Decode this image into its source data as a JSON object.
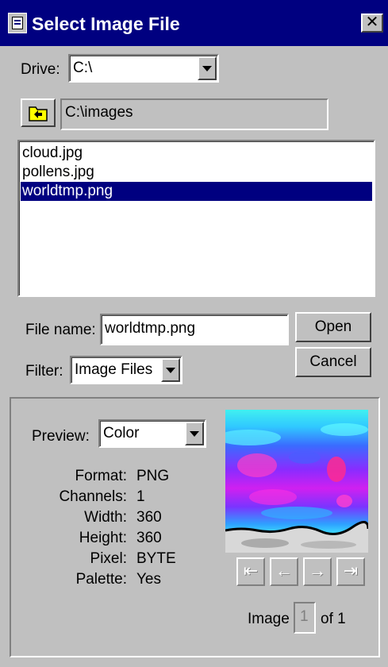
{
  "window": {
    "title": "Select Image File",
    "close_glyph": "✕"
  },
  "drive": {
    "label": "Drive:",
    "value": "C:\\"
  },
  "directory": {
    "path": "C:\\images"
  },
  "files": [
    {
      "name": "cloud.jpg",
      "selected": false
    },
    {
      "name": "pollens.jpg",
      "selected": false
    },
    {
      "name": "worldtmp.png",
      "selected": true
    }
  ],
  "filename": {
    "label": "File name:",
    "value": "worldtmp.png"
  },
  "filter": {
    "label": "Filter:",
    "value": "Image Files"
  },
  "buttons": {
    "open": "Open",
    "cancel": "Cancel"
  },
  "preview": {
    "label": "Preview:",
    "mode": "Color",
    "info": [
      {
        "label": "Format:",
        "value": "PNG"
      },
      {
        "label": "Channels:",
        "value": "1"
      },
      {
        "label": "Width:",
        "value": "360"
      },
      {
        "label": "Height:",
        "value": "360"
      },
      {
        "label": "Pixel:",
        "value": "BYTE"
      },
      {
        "label": "Palette:",
        "value": "Yes"
      }
    ],
    "nav": {
      "first": "⇤",
      "prev": "←",
      "next": "→",
      "last": "⇥"
    },
    "image_label": "Image",
    "image_index": "1",
    "image_total": "of 1"
  },
  "colors": {
    "titlebar": "#000080",
    "selection": "#000080",
    "face": "#c0c0c0"
  }
}
